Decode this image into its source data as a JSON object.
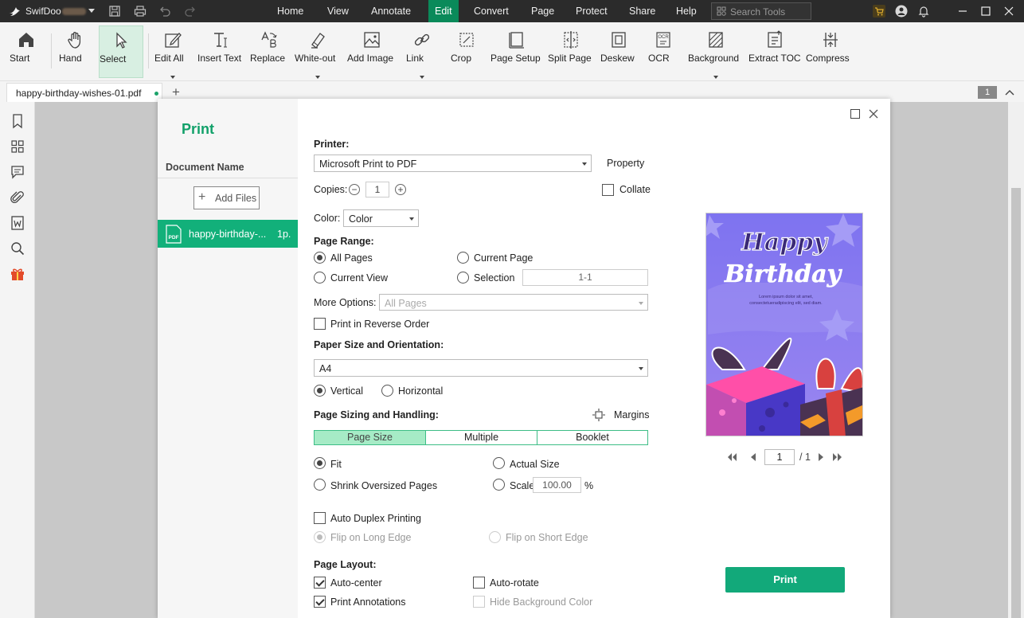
{
  "titlebar": {
    "app_name": "SwifDoo",
    "menus": [
      "Home",
      "View",
      "Annotate",
      "Edit",
      "Convert",
      "Page",
      "Protect",
      "Share",
      "Help"
    ],
    "active_menu": "Edit",
    "search_placeholder": "Search Tools"
  },
  "ribbon": {
    "tools": [
      {
        "label": "Start",
        "icon": "home-icon"
      },
      {
        "label": "Hand",
        "icon": "hand-icon"
      },
      {
        "label": "Select",
        "icon": "cursor-icon",
        "selected": true
      },
      {
        "label": "Edit All",
        "icon": "edit-icon",
        "dropdown": true
      },
      {
        "label": "Insert Text",
        "icon": "text-icon"
      },
      {
        "label": "Replace",
        "icon": "replace-icon"
      },
      {
        "label": "White-out",
        "icon": "eraser-icon",
        "dropdown": true
      },
      {
        "label": "Add Image",
        "icon": "image-icon"
      },
      {
        "label": "Link",
        "icon": "link-icon",
        "dropdown": true
      },
      {
        "label": "Crop",
        "icon": "crop-icon"
      },
      {
        "label": "Page Setup",
        "icon": "page-setup-icon"
      },
      {
        "label": "Split Page",
        "icon": "split-page-icon"
      },
      {
        "label": "Deskew",
        "icon": "deskew-icon"
      },
      {
        "label": "OCR",
        "icon": "ocr-icon"
      },
      {
        "label": "Background",
        "icon": "background-icon",
        "dropdown": true
      },
      {
        "label": "Extract TOC",
        "icon": "extract-toc-icon"
      },
      {
        "label": "Compress",
        "icon": "compress-icon"
      }
    ]
  },
  "tabs": {
    "doc_tab": "happy-birthday-wishes-01.pdf",
    "add_tab": "+",
    "page_badge": "1"
  },
  "print_dialog": {
    "title": "Print",
    "document_name_header": "Document Name",
    "add_files": "Add Files",
    "file_name": "happy-birthday-...",
    "file_pages": "1p.",
    "printer_label": "Printer:",
    "printer_value": "Microsoft Print to PDF",
    "property": "Property",
    "copies_label": "Copies:",
    "copies_value": "1",
    "collate": "Collate",
    "color_label": "Color:",
    "color_value": "Color",
    "page_range_label": "Page Range:",
    "all_pages": "All Pages",
    "current_page": "Current Page",
    "current_view": "Current View",
    "selection": "Selection",
    "selection_value": "1-1",
    "more_options_label": "More Options:",
    "more_options_value": "All Pages",
    "reverse_order": "Print in Reverse Order",
    "paper_label": "Paper Size and Orientation:",
    "paper_value": "A4",
    "vertical": "Vertical",
    "horizontal": "Horizontal",
    "sizing_label": "Page Sizing and Handling:",
    "margins": "Margins",
    "seg_page_size": "Page Size",
    "seg_multiple": "Multiple",
    "seg_booklet": "Booklet",
    "fit": "Fit",
    "actual_size": "Actual Size",
    "shrink": "Shrink Oversized Pages",
    "scale": "Scale",
    "scale_value": "100.00",
    "percent": "%",
    "duplex": "Auto Duplex Printing",
    "flip_long": "Flip on Long Edge",
    "flip_short": "Flip on Short Edge",
    "layout_label": "Page Layout:",
    "auto_center": "Auto-center",
    "auto_rotate": "Auto-rotate",
    "print_annotations": "Print Annotations",
    "hide_bg": "Hide Background Color",
    "preview_page": "1",
    "preview_total": "/ 1",
    "print_button": "Print"
  },
  "preview_card": {
    "line1": "Happy",
    "line2": "Birthday",
    "text1": "Lorem ipsum dolor sit amet,",
    "text2": "consectetueradipiscing elit, sed diam."
  },
  "colors": {
    "accent": "#12a97a",
    "titlebar_bg": "#2b2b2b",
    "card_bg": "#8677ee"
  }
}
